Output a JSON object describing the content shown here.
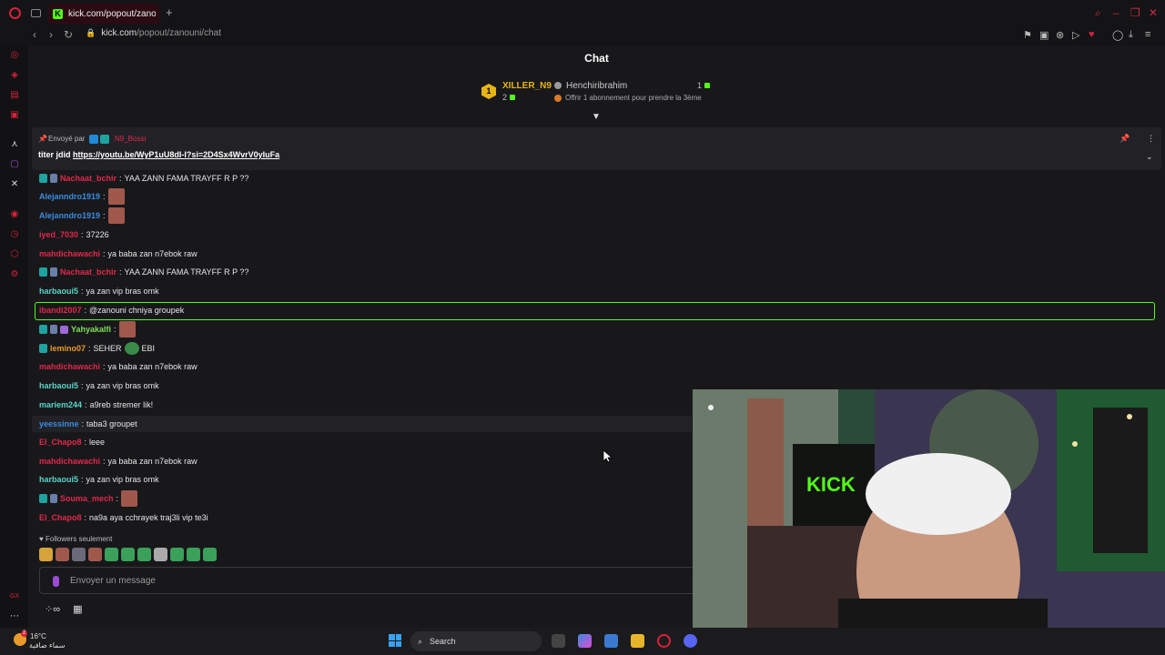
{
  "browser": {
    "tab_title": "kick.com/popout/zanouni",
    "tab_favicon": "K",
    "url_host": "kick.com",
    "url_path": "/popout/zanouni/chat",
    "accent": "#d8213a"
  },
  "chat": {
    "title": "Chat",
    "leaderboard": {
      "rank": "1",
      "top_user": "XILLER_N9",
      "top_count": "2",
      "second_user": "Henchiribrahim",
      "second_count": "1",
      "gift_text": "Offrir 1 abonnement pour prendre la 3ème"
    },
    "pinned": {
      "by_label": "Envoyé par",
      "by_user": "N9_Bossi",
      "message_prefix": "titer jdid",
      "message_link": "https://youtu.be/WyP1uU8dI-I?si=2D4Sx4WvrV0yIuFa"
    },
    "messages": [
      {
        "user": "Nachaat_bchir",
        "color": "#e0284a",
        "text": "YAA ZANN FAMA TRAYFF R P ??"
      },
      {
        "user": "Alejanndro1919",
        "color": "#3a8ce0",
        "text": ""
      },
      {
        "user": "Alejanndro1919",
        "color": "#3a8ce0",
        "text": ""
      },
      {
        "user": "iyed_7030",
        "color": "#e0284a",
        "text": "37226"
      },
      {
        "user": "mahdichawachi",
        "color": "#e0284a",
        "text": "ya baba zan n7ebok raw"
      },
      {
        "user": "Nachaat_bchir",
        "color": "#e0284a",
        "text": "YAA ZANN FAMA TRAYFF R P ??"
      },
      {
        "user": "harbaoui5",
        "color": "#5ad3c7",
        "text": "ya zan vip bras omk"
      },
      {
        "user": "ibandi2007",
        "color": "#e0284a",
        "text": "@zanouni chniya groupek"
      },
      {
        "user": "Yahyakalfi",
        "color": "#7be05a",
        "text": ""
      },
      {
        "user": "lemino07",
        "color": "#e89a2a",
        "text": "SEHER",
        "text2": "EBI"
      },
      {
        "user": "mahdichawachi",
        "color": "#e0284a",
        "text": "ya baba zan n7ebok raw"
      },
      {
        "user": "harbaoui5",
        "color": "#5ad3c7",
        "text": "ya zan vip bras omk"
      },
      {
        "user": "mariem244",
        "color": "#5ad3c7",
        "text": "a9reb stremer lik!"
      },
      {
        "user": "yeessinne",
        "color": "#3a8ce0",
        "text": "taba3 groupet"
      },
      {
        "user": "El_Chapo8",
        "color": "#e0284a",
        "text": "leee"
      },
      {
        "user": "mahdichawachi",
        "color": "#e0284a",
        "text": "ya baba zan n7ebok raw"
      },
      {
        "user": "harbaoui5",
        "color": "#5ad3c7",
        "text": "ya zan vip bras omk"
      },
      {
        "user": "Souma_mech",
        "color": "#e0284a",
        "text": ""
      },
      {
        "user": "El_Chapo8",
        "color": "#e0284a",
        "text": "na9a aya cchrayek traj3li vip te3i"
      }
    ],
    "followers_only": "Followers seulement",
    "input_placeholder": "Envoyer un message"
  },
  "taskbar": {
    "temperature": "16°C",
    "weather_desc": "سماء صافية",
    "weather_badge": "2",
    "search_label": "Search"
  }
}
